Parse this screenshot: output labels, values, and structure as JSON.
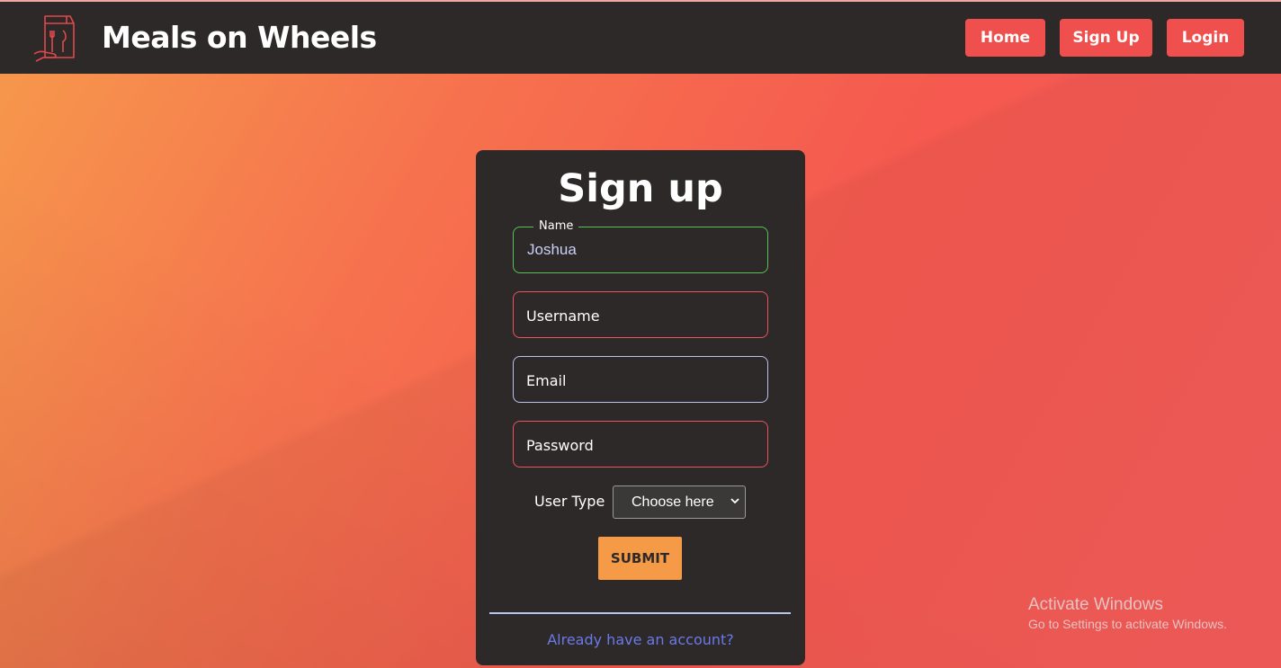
{
  "header": {
    "brand": "Meals on Wheels",
    "nav": {
      "home": "Home",
      "signup": "Sign Up",
      "login": "Login"
    }
  },
  "form": {
    "title": "Sign up",
    "name": {
      "legend": "Name",
      "value": "Joshua"
    },
    "username": {
      "placeholder": "Username"
    },
    "email": {
      "placeholder": "Email"
    },
    "password": {
      "placeholder": "Password"
    },
    "user_type": {
      "label": "User Type",
      "selected": "Choose here"
    },
    "submit_label": "SUBMIT",
    "account_link": "Already have an account?"
  },
  "watermark": {
    "title": "Activate Windows",
    "subtitle": "Go to Settings to activate Windows."
  },
  "colors": {
    "navbar": "#2e2929",
    "nav_button": "#f0504d",
    "submit": "#f59a46",
    "link": "#6a79e8"
  },
  "icons": {
    "logo": "meal-bag-icon",
    "select_arrow": "chevron-down-icon"
  }
}
